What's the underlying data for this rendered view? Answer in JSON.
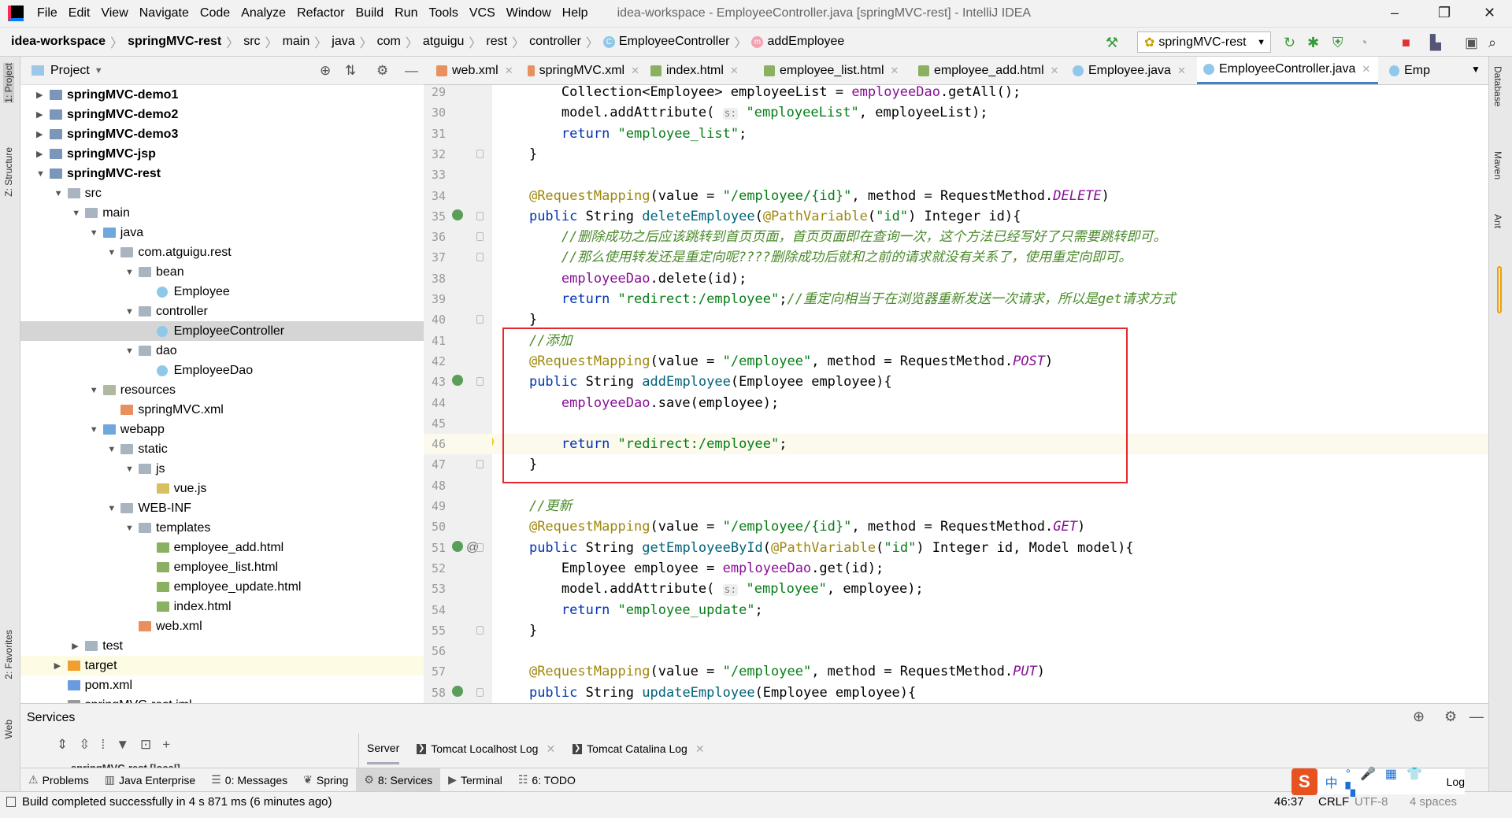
{
  "app": {
    "title": "idea-workspace - EmployeeController.java [springMVC-rest] - IntelliJ IDEA",
    "win_min": "–",
    "win_max": "❐",
    "win_close": "✕"
  },
  "menu": [
    "File",
    "Edit",
    "View",
    "Navigate",
    "Code",
    "Analyze",
    "Refactor",
    "Build",
    "Run",
    "Tools",
    "VCS",
    "Window",
    "Help"
  ],
  "breadcrumb": [
    "idea-workspace",
    "springMVC-rest",
    "src",
    "main",
    "java",
    "com",
    "atguigu",
    "rest",
    "controller",
    "EmployeeController",
    "addEmployee"
  ],
  "toolbar": {
    "run_config": "springMVC-rest"
  },
  "stripe_left": {
    "project": "1: Project",
    "structure": "Z: Structure",
    "favorites": "2: Favorites",
    "web": "Web"
  },
  "stripe_right": {
    "database": "Database",
    "maven": "Maven",
    "ant": "Ant"
  },
  "project": {
    "title": "Project",
    "tree": [
      {
        "label": "springMVC-demo1",
        "depth": 0,
        "type": "module",
        "state": "collapsed"
      },
      {
        "label": "springMVC-demo2",
        "depth": 0,
        "type": "module",
        "state": "collapsed"
      },
      {
        "label": "springMVC-demo3",
        "depth": 0,
        "type": "module",
        "state": "collapsed"
      },
      {
        "label": "springMVC-jsp",
        "depth": 0,
        "type": "module",
        "state": "collapsed"
      },
      {
        "label": "springMVC-rest",
        "depth": 0,
        "type": "module",
        "state": "expanded"
      },
      {
        "label": "src",
        "depth": 1,
        "type": "folder",
        "state": "expanded"
      },
      {
        "label": "main",
        "depth": 2,
        "type": "folder",
        "state": "expanded"
      },
      {
        "label": "java",
        "depth": 3,
        "type": "source",
        "state": "expanded"
      },
      {
        "label": "com.atguigu.rest",
        "depth": 4,
        "type": "package",
        "state": "expanded"
      },
      {
        "label": "bean",
        "depth": 5,
        "type": "package",
        "state": "expanded"
      },
      {
        "label": "Employee",
        "depth": 6,
        "type": "class"
      },
      {
        "label": "controller",
        "depth": 5,
        "type": "package",
        "state": "expanded"
      },
      {
        "label": "EmployeeController",
        "depth": 6,
        "type": "class",
        "selected": true
      },
      {
        "label": "dao",
        "depth": 5,
        "type": "package",
        "state": "expanded"
      },
      {
        "label": "EmployeeDao",
        "depth": 6,
        "type": "class"
      },
      {
        "label": "resources",
        "depth": 3,
        "type": "resources",
        "state": "expanded"
      },
      {
        "label": "springMVC.xml",
        "depth": 4,
        "type": "xml"
      },
      {
        "label": "webapp",
        "depth": 3,
        "type": "webfolder",
        "state": "expanded"
      },
      {
        "label": "static",
        "depth": 4,
        "type": "folder",
        "state": "expanded"
      },
      {
        "label": "js",
        "depth": 5,
        "type": "folder",
        "state": "expanded"
      },
      {
        "label": "vue.js",
        "depth": 6,
        "type": "js"
      },
      {
        "label": "WEB-INF",
        "depth": 4,
        "type": "folder",
        "state": "expanded"
      },
      {
        "label": "templates",
        "depth": 5,
        "type": "folder",
        "state": "expanded"
      },
      {
        "label": "employee_add.html",
        "depth": 6,
        "type": "html"
      },
      {
        "label": "employee_list.html",
        "depth": 6,
        "type": "html"
      },
      {
        "label": "employee_update.html",
        "depth": 6,
        "type": "html"
      },
      {
        "label": "index.html",
        "depth": 6,
        "type": "html"
      },
      {
        "label": "web.xml",
        "depth": 5,
        "type": "xml"
      },
      {
        "label": "test",
        "depth": 2,
        "type": "folder",
        "state": "collapsed"
      },
      {
        "label": "target",
        "depth": 1,
        "type": "excluded",
        "state": "collapsed",
        "highlight": true
      },
      {
        "label": "pom.xml",
        "depth": 1,
        "type": "maven"
      },
      {
        "label": "springMVC-rest.iml",
        "depth": 1,
        "type": "iml"
      }
    ]
  },
  "tabs": [
    {
      "label": "web.xml",
      "type": "xml"
    },
    {
      "label": "springMVC.xml",
      "type": "xml"
    },
    {
      "label": "index.html",
      "type": "html"
    },
    {
      "label": "employee_list.html",
      "type": "html"
    },
    {
      "label": "employee_add.html",
      "type": "html"
    },
    {
      "label": "Employee.java",
      "type": "class"
    },
    {
      "label": "EmployeeController.java",
      "type": "class",
      "active": true
    },
    {
      "label": "Emp",
      "type": "class"
    }
  ],
  "editor": {
    "current_line": 46,
    "lines": [
      {
        "n": 29,
        "t": [
          [
            "p",
            "        Collection<Employee> employeeList = "
          ],
          [
            "field",
            "employeeDao"
          ],
          [
            "p",
            ".getAll();"
          ]
        ]
      },
      {
        "n": 30,
        "t": [
          [
            "p",
            "        model.addAttribute( "
          ],
          [
            "hint",
            "s:"
          ],
          [
            "p",
            " "
          ],
          [
            "str",
            "\"employeeList\""
          ],
          [
            "p",
            ", employeeList);"
          ]
        ]
      },
      {
        "n": 31,
        "t": [
          [
            "p",
            "        "
          ],
          [
            "kw",
            "return "
          ],
          [
            "str",
            "\"employee_list\""
          ],
          [
            "p",
            ";"
          ]
        ]
      },
      {
        "n": 32,
        "t": [
          [
            "p",
            "    }"
          ]
        ]
      },
      {
        "n": 33,
        "t": []
      },
      {
        "n": 34,
        "t": [
          [
            "p",
            "    "
          ],
          [
            "ann",
            "@RequestMapping"
          ],
          [
            "p",
            "(value = "
          ],
          [
            "str",
            "\"/employee/{id}\""
          ],
          [
            "p",
            ", method = RequestMethod."
          ],
          [
            "const",
            "DELETE"
          ],
          [
            "p",
            ")"
          ]
        ]
      },
      {
        "n": 35,
        "t": [
          [
            "p",
            "    "
          ],
          [
            "kw",
            "public "
          ],
          [
            "p",
            "String "
          ],
          [
            "method",
            "deleteEmployee"
          ],
          [
            "p",
            "("
          ],
          [
            "ann",
            "@PathVariable"
          ],
          [
            "p",
            "("
          ],
          [
            "str",
            "\"id\""
          ],
          [
            "p",
            ") Integer id){"
          ]
        ]
      },
      {
        "n": 36,
        "t": [
          [
            "p",
            "        "
          ],
          [
            "com",
            "//删除成功之后应该跳转到首页页面，首页页面即在查询一次，这个方法已经写好了只需要跳转即可。"
          ]
        ]
      },
      {
        "n": 37,
        "t": [
          [
            "p",
            "        "
          ],
          [
            "com",
            "//那么使用转发还是重定向呢????删除成功后就和之前的请求就没有关系了，使用重定向即可。"
          ]
        ]
      },
      {
        "n": 38,
        "t": [
          [
            "p",
            "        "
          ],
          [
            "field",
            "employeeDao"
          ],
          [
            "p",
            ".delete(id);"
          ]
        ]
      },
      {
        "n": 39,
        "t": [
          [
            "p",
            "        "
          ],
          [
            "kw",
            "return "
          ],
          [
            "str",
            "\"redirect:/employee\""
          ],
          [
            "p",
            ";"
          ],
          [
            "com",
            "//重定向相当于在浏览器重新发送一次请求，所以是get请求方式"
          ]
        ]
      },
      {
        "n": 40,
        "t": [
          [
            "p",
            "    }"
          ]
        ]
      },
      {
        "n": 41,
        "t": [
          [
            "p",
            "    "
          ],
          [
            "com",
            "//添加"
          ]
        ]
      },
      {
        "n": 42,
        "t": [
          [
            "p",
            "    "
          ],
          [
            "ann",
            "@RequestMapping"
          ],
          [
            "p",
            "(value = "
          ],
          [
            "str",
            "\"/employee\""
          ],
          [
            "p",
            ", method = RequestMethod."
          ],
          [
            "const",
            "POST"
          ],
          [
            "p",
            ")"
          ]
        ]
      },
      {
        "n": 43,
        "t": [
          [
            "p",
            "    "
          ],
          [
            "kw",
            "public "
          ],
          [
            "p",
            "String "
          ],
          [
            "method",
            "addEmployee"
          ],
          [
            "p",
            "(Employee employee){"
          ]
        ]
      },
      {
        "n": 44,
        "t": [
          [
            "p",
            "        "
          ],
          [
            "field",
            "employeeDao"
          ],
          [
            "p",
            ".save(employee);"
          ]
        ]
      },
      {
        "n": 45,
        "t": []
      },
      {
        "n": 46,
        "t": [
          [
            "p",
            "        "
          ],
          [
            "kw",
            "return "
          ],
          [
            "str",
            "\"redirect:/employee\""
          ],
          [
            "p",
            ";"
          ]
        ]
      },
      {
        "n": 47,
        "t": [
          [
            "p",
            "    }"
          ]
        ]
      },
      {
        "n": 48,
        "t": []
      },
      {
        "n": 49,
        "t": [
          [
            "p",
            "    "
          ],
          [
            "com",
            "//更新"
          ]
        ]
      },
      {
        "n": 50,
        "t": [
          [
            "p",
            "    "
          ],
          [
            "ann",
            "@RequestMapping"
          ],
          [
            "p",
            "(value = "
          ],
          [
            "str",
            "\"/employee/{id}\""
          ],
          [
            "p",
            ", method = RequestMethod."
          ],
          [
            "const",
            "GET"
          ],
          [
            "p",
            ")"
          ]
        ]
      },
      {
        "n": 51,
        "t": [
          [
            "p",
            "    "
          ],
          [
            "kw",
            "public "
          ],
          [
            "p",
            "String "
          ],
          [
            "method",
            "getEmployeeById"
          ],
          [
            "p",
            "("
          ],
          [
            "ann",
            "@PathVariable"
          ],
          [
            "p",
            "("
          ],
          [
            "str",
            "\"id\""
          ],
          [
            "p",
            ") Integer id, Model model){"
          ]
        ]
      },
      {
        "n": 52,
        "t": [
          [
            "p",
            "        Employee employee = "
          ],
          [
            "field",
            "employeeDao"
          ],
          [
            "p",
            ".get(id);"
          ]
        ]
      },
      {
        "n": 53,
        "t": [
          [
            "p",
            "        model.addAttribute( "
          ],
          [
            "hint",
            "s:"
          ],
          [
            "p",
            " "
          ],
          [
            "str",
            "\"employee\""
          ],
          [
            "p",
            ", employee);"
          ]
        ]
      },
      {
        "n": 54,
        "t": [
          [
            "p",
            "        "
          ],
          [
            "kw",
            "return "
          ],
          [
            "str",
            "\"employee_update\""
          ],
          [
            "p",
            ";"
          ]
        ]
      },
      {
        "n": 55,
        "t": [
          [
            "p",
            "    }"
          ]
        ]
      },
      {
        "n": 56,
        "t": []
      },
      {
        "n": 57,
        "t": [
          [
            "p",
            "    "
          ],
          [
            "ann",
            "@RequestMapping"
          ],
          [
            "p",
            "(value = "
          ],
          [
            "str",
            "\"/employee\""
          ],
          [
            "p",
            ", method = RequestMethod."
          ],
          [
            "const",
            "PUT"
          ],
          [
            "p",
            ")"
          ]
        ]
      },
      {
        "n": 58,
        "t": [
          [
            "p",
            "    "
          ],
          [
            "kw",
            "public "
          ],
          [
            "p",
            "String "
          ],
          [
            "method",
            "updateEmployee"
          ],
          [
            "p",
            "(Employee employee){"
          ]
        ]
      }
    ]
  },
  "services": {
    "title": "Services",
    "tabs": [
      "Server",
      "Tomcat Localhost Log",
      "Tomcat Catalina Log"
    ],
    "tree_item": "springMVC-rest [local]"
  },
  "bottom_tabs": [
    "Problems",
    "Java Enterprise",
    "0: Messages",
    "Spring",
    "8: Services",
    "Terminal",
    "6: TODO"
  ],
  "bottom_active": "8: Services",
  "status": {
    "message": "Build completed successfully in 4 s 871 ms (6 minutes ago)",
    "position": "46:37",
    "line_sep": "CRLF",
    "encoding": "UTF-8",
    "indent": "4 spaces",
    "event_log": "Log"
  },
  "ime": {
    "lang": "中"
  },
  "colors": {
    "accent": "#4083c9",
    "highlight_box": "#e8262e",
    "keyword": "#0033b3",
    "string": "#067d17",
    "annotation": "#9e880d",
    "comment": "#4b8b2b"
  }
}
